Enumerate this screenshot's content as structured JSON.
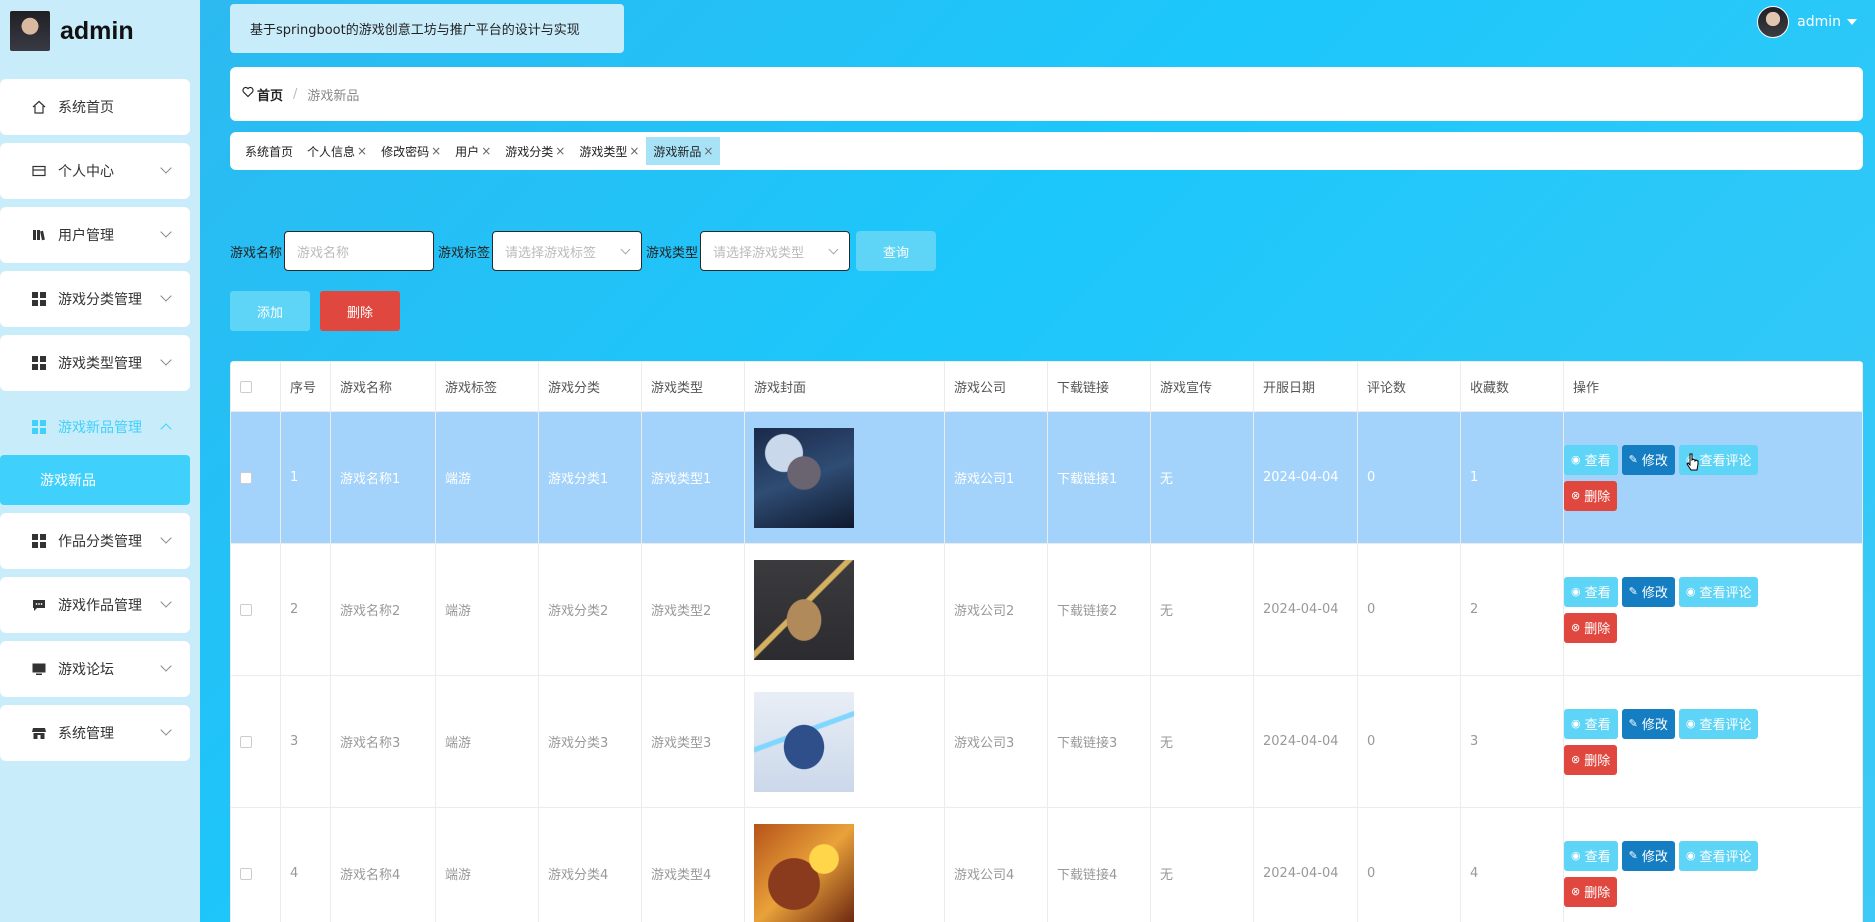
{
  "brand": {
    "name": "admin"
  },
  "topbar": {
    "title": "基于springboot的游戏创意工坊与推广平台的设计与实现",
    "user_name": "admin"
  },
  "sidebar": {
    "items": [
      {
        "label": "系统首页",
        "icon": "home-icon"
      },
      {
        "label": "个人中心",
        "icon": "card-icon"
      },
      {
        "label": "用户管理",
        "icon": "library-icon"
      },
      {
        "label": "游戏分类管理",
        "icon": "grid-icon"
      },
      {
        "label": "游戏类型管理",
        "icon": "grid-icon"
      },
      {
        "label": "游戏新品管理",
        "icon": "grid-icon",
        "active": true
      },
      {
        "label": "作品分类管理",
        "icon": "grid-icon"
      },
      {
        "label": "游戏作品管理",
        "icon": "chat-icon"
      },
      {
        "label": "游戏论坛",
        "icon": "monitor-icon"
      },
      {
        "label": "系统管理",
        "icon": "store-icon"
      }
    ],
    "sub_active": "游戏新品"
  },
  "breadcrumb": {
    "home": "首页",
    "sep": "/",
    "current": "游戏新品"
  },
  "tabs": [
    "系统首页",
    "个人信息",
    "修改密码",
    "用户",
    "游戏分类",
    "游戏类型",
    "游戏新品"
  ],
  "filter": {
    "name_label": "游戏名称",
    "name_placeholder": "游戏名称",
    "tag_label": "游戏标签",
    "tag_placeholder": "请选择游戏标签",
    "type_label": "游戏类型",
    "type_placeholder": "请选择游戏类型",
    "query": "查询"
  },
  "actions": {
    "add": "添加",
    "delete": "删除"
  },
  "table": {
    "headers": [
      "序号",
      "游戏名称",
      "游戏标签",
      "游戏分类",
      "游戏类型",
      "游戏封面",
      "游戏公司",
      "下载链接",
      "游戏宣传",
      "开服日期",
      "评论数",
      "收藏数",
      "操作"
    ],
    "rows": [
      {
        "no": "1",
        "name": "游戏名称1",
        "tag": "端游",
        "cat": "游戏分类1",
        "type": "游戏类型1",
        "company": "游戏公司1",
        "link": "下载链接1",
        "promo": "无",
        "date": "2024-04-04",
        "comments": "0",
        "favs": "1"
      },
      {
        "no": "2",
        "name": "游戏名称2",
        "tag": "端游",
        "cat": "游戏分类2",
        "type": "游戏类型2",
        "company": "游戏公司2",
        "link": "下载链接2",
        "promo": "无",
        "date": "2024-04-04",
        "comments": "0",
        "favs": "2"
      },
      {
        "no": "3",
        "name": "游戏名称3",
        "tag": "端游",
        "cat": "游戏分类3",
        "type": "游戏类型3",
        "company": "游戏公司3",
        "link": "下载链接3",
        "promo": "无",
        "date": "2024-04-04",
        "comments": "0",
        "favs": "3"
      },
      {
        "no": "4",
        "name": "游戏名称4",
        "tag": "端游",
        "cat": "游戏分类4",
        "type": "游戏类型4",
        "company": "游戏公司4",
        "link": "下载链接4",
        "promo": "无",
        "date": "2024-04-04",
        "comments": "0",
        "favs": "4"
      }
    ],
    "ops": {
      "view": "查看",
      "edit": "修改",
      "view_comments": "查看评论",
      "delete": "删除"
    }
  },
  "colors": {
    "accent": "#3fd1fb",
    "danger": "#e0483f",
    "edit": "#157ec2",
    "selected_row": "#a3d3fa"
  }
}
